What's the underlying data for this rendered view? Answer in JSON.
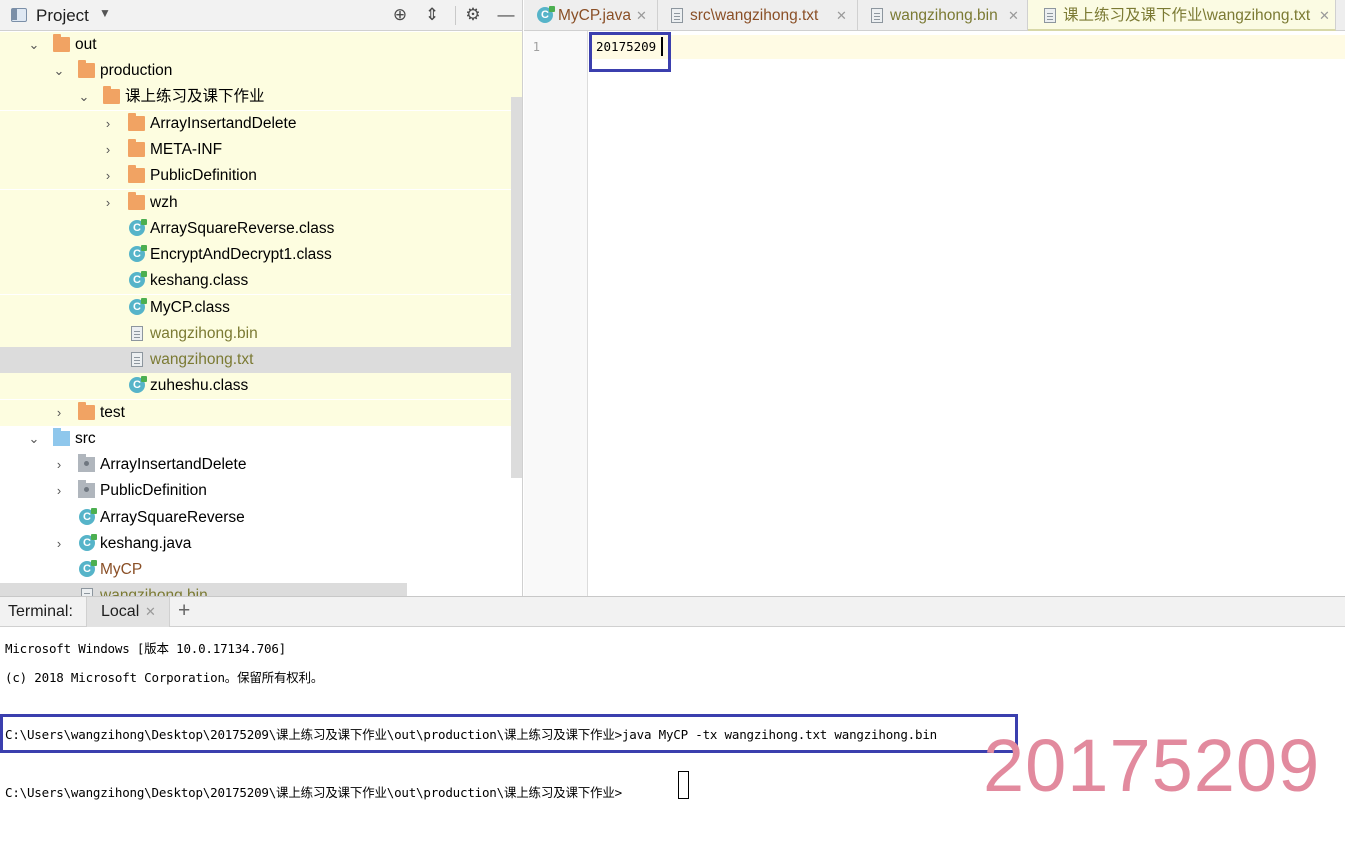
{
  "project_panel": {
    "title": "Project",
    "tree": [
      {
        "label": "out",
        "level": 1,
        "expanded": true,
        "icon": "folder-orange"
      },
      {
        "label": "production",
        "level": 2,
        "expanded": true,
        "icon": "folder-orange"
      },
      {
        "label": "课上练习及课下作业",
        "level": 3,
        "expanded": true,
        "icon": "folder-orange"
      },
      {
        "label": "ArrayInsertandDelete",
        "level": 4,
        "expanded": false,
        "icon": "folder-orange"
      },
      {
        "label": "META-INF",
        "level": 4,
        "expanded": false,
        "icon": "folder-orange"
      },
      {
        "label": "PublicDefinition",
        "level": 4,
        "expanded": false,
        "icon": "folder-orange"
      },
      {
        "label": "wzh",
        "level": 4,
        "expanded": false,
        "icon": "folder-orange"
      },
      {
        "label": "ArraySquareReverse.class",
        "level": 4,
        "icon": "class-file"
      },
      {
        "label": "EncryptAndDecrypt1.class",
        "level": 4,
        "icon": "class-file"
      },
      {
        "label": "keshang.class",
        "level": 4,
        "icon": "class-file"
      },
      {
        "label": "MyCP.class",
        "level": 4,
        "icon": "class-file"
      },
      {
        "label": "wangzihong.bin",
        "level": 4,
        "icon": "text-file"
      },
      {
        "label": "wangzihong.txt",
        "level": 4,
        "icon": "text-file",
        "selected": true
      },
      {
        "label": "zuheshu.class",
        "level": 4,
        "icon": "class-file"
      },
      {
        "label": "test",
        "level": 2,
        "expanded": false,
        "icon": "folder-orange"
      },
      {
        "label": "src",
        "level": 1,
        "expanded": true,
        "icon": "folder-blue"
      },
      {
        "label": "ArrayInsertandDelete",
        "level": 2,
        "expanded": false,
        "icon": "package"
      },
      {
        "label": "PublicDefinition",
        "level": 2,
        "expanded": false,
        "icon": "package"
      },
      {
        "label": "ArraySquareReverse",
        "level": 2,
        "icon": "class-file"
      },
      {
        "label": "keshang.java",
        "level": 2,
        "expanded": false,
        "icon": "class-file"
      },
      {
        "label": "MyCP",
        "level": 2,
        "icon": "class-file"
      },
      {
        "label": "wangzihong.bin",
        "level": 2,
        "icon": "text-file"
      }
    ]
  },
  "editor": {
    "tabs": [
      {
        "label": "MyCP.java",
        "icon": "class-icon",
        "color": "#8a4f26"
      },
      {
        "label": "src\\wangzihong.txt",
        "icon": "file-icon",
        "color": "#8a4f26"
      },
      {
        "label": "wangzihong.bin",
        "icon": "file-icon",
        "color": "#7b7a33"
      },
      {
        "label": "课上练习及课下作业\\wangzihong.txt",
        "icon": "file-icon",
        "color": "#7b7a33",
        "active": true
      }
    ],
    "line_number": "1",
    "content": "20175209"
  },
  "terminal": {
    "title": "Terminal:",
    "tab_label": "Local",
    "add_label": "+",
    "lines": [
      "Microsoft Windows [版本 10.0.17134.706]",
      "(c) 2018 Microsoft Corporation。保留所有权利。",
      "C:\\Users\\wangzihong\\Desktop\\20175209\\课上练习及课下作业\\out\\production\\课上练习及课下作业>java MyCP -tx wangzihong.txt wangzihong.bin",
      "C:\\Users\\wangzihong\\Desktop\\20175209\\课上练习及课下作业\\out\\production\\课上练习及课下作业>"
    ]
  },
  "watermark": "20175209",
  "colors": {
    "highlight_box": "#3b3fae",
    "watermark": "#e28a9e",
    "modified_file": "#7b7a33",
    "changed_file": "#8a4f26"
  }
}
